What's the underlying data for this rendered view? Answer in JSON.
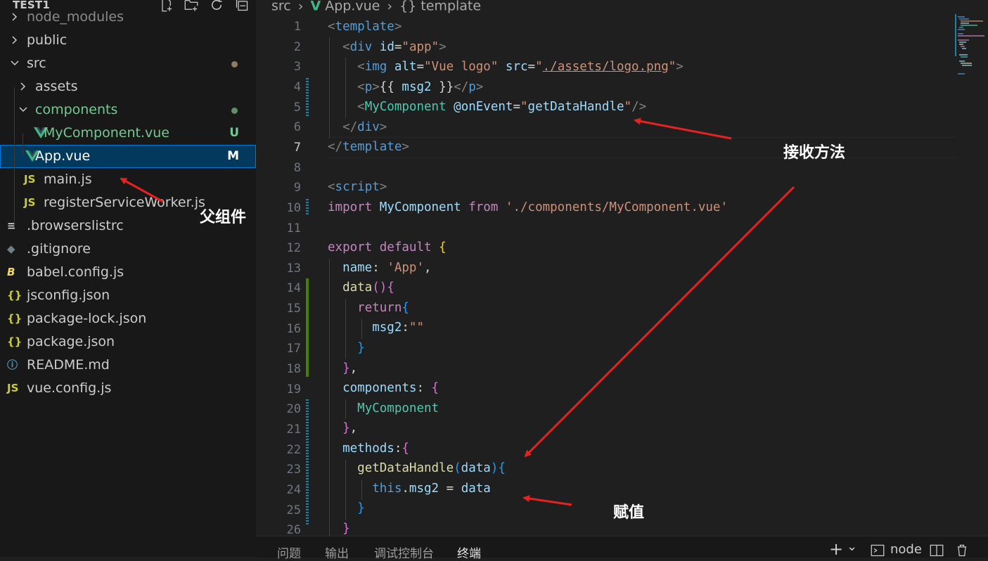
{
  "explorer": {
    "title": "TEST1",
    "items": [
      {
        "label": "node_modules",
        "type": "folder",
        "state": "collapsed",
        "color": "#8b8b8b"
      },
      {
        "label": "public",
        "type": "folder",
        "state": "collapsed",
        "color": "#cccccc"
      },
      {
        "label": "src",
        "type": "folder",
        "state": "expanded",
        "color": "#cccccc"
      },
      {
        "label": "assets",
        "type": "folder",
        "state": "collapsed",
        "color": "#cccccc"
      },
      {
        "label": "components",
        "type": "folder",
        "state": "expanded",
        "color": "#73c991"
      },
      {
        "label": "MyComponent.vue",
        "type": "vue",
        "badge": "U",
        "color": "#73c991"
      },
      {
        "label": "App.vue",
        "type": "vue",
        "badge": "M",
        "color": "#ffffff"
      },
      {
        "label": "main.js",
        "type": "js",
        "icon_text": "JS",
        "color": "#cccccc"
      },
      {
        "label": "registerServiceWorker.js",
        "type": "js",
        "icon_text": "JS",
        "color": "#cccccc"
      },
      {
        "label": ".browserslistrc",
        "type": "text",
        "icon_text": "≡",
        "color": "#cccccc"
      },
      {
        "label": ".gitignore",
        "type": "git",
        "icon_text": "◆",
        "color": "#cccccc"
      },
      {
        "label": "babel.config.js",
        "type": "babel",
        "icon_text": "B",
        "color": "#cccccc"
      },
      {
        "label": "jsconfig.json",
        "type": "json",
        "icon_text": "{}",
        "color": "#cccccc"
      },
      {
        "label": "package-lock.json",
        "type": "json",
        "icon_text": "{}",
        "color": "#cccccc"
      },
      {
        "label": "package.json",
        "type": "json",
        "icon_text": "{}",
        "color": "#cccccc"
      },
      {
        "label": "README.md",
        "type": "info",
        "icon_text": "ⓘ",
        "color": "#cccccc"
      },
      {
        "label": "vue.config.js",
        "type": "js",
        "icon_text": "JS",
        "color": "#cccccc"
      }
    ]
  },
  "breadcrumb": {
    "folder": "src",
    "file": "App.vue",
    "symbol": "template",
    "symbol_icon": "{}"
  },
  "editor": {
    "active_line": 7,
    "lines": [
      {
        "n": "1"
      },
      {
        "n": "2"
      },
      {
        "n": "3"
      },
      {
        "n": "4"
      },
      {
        "n": "5"
      },
      {
        "n": "6"
      },
      {
        "n": "7"
      },
      {
        "n": "8"
      },
      {
        "n": "9"
      },
      {
        "n": "10"
      },
      {
        "n": "11"
      },
      {
        "n": "12"
      },
      {
        "n": "13"
      },
      {
        "n": "14"
      },
      {
        "n": "15"
      },
      {
        "n": "16"
      },
      {
        "n": "17"
      },
      {
        "n": "18"
      },
      {
        "n": "19"
      },
      {
        "n": "20"
      },
      {
        "n": "21"
      },
      {
        "n": "22"
      },
      {
        "n": "23"
      },
      {
        "n": "24"
      },
      {
        "n": "25"
      },
      {
        "n": "26"
      }
    ]
  },
  "panel": {
    "tabs": [
      "问题",
      "输出",
      "调试控制台",
      "终端"
    ],
    "active_tab": "终端",
    "terminal_name": "node",
    "new_terminal_icon": "+",
    "dropdown_icon": "⌄"
  },
  "annotations": {
    "receive": "接收方法",
    "parent": "父组件",
    "assign": "赋值",
    "arrow_color": "#e52222"
  }
}
